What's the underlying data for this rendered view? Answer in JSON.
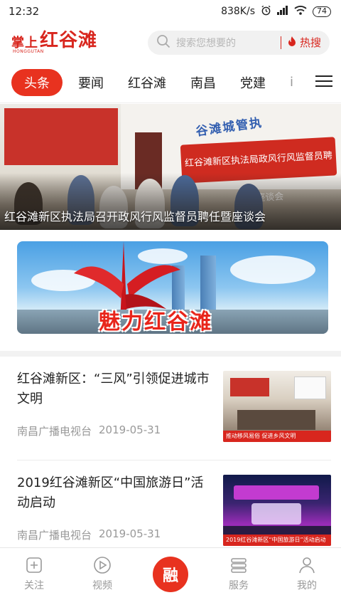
{
  "status_bar": {
    "time": "12:32",
    "network_speed": "838K/s",
    "battery": "74"
  },
  "header": {
    "logo_small": "掌上",
    "logo_main": "红谷滩",
    "logo_sub": "HONGGUTAN",
    "search_placeholder": "搜索您想要的",
    "hot_search_label": "热搜"
  },
  "tabs": [
    {
      "label": "头条",
      "active": true
    },
    {
      "label": "要闻",
      "active": false
    },
    {
      "label": "红谷滩",
      "active": false
    },
    {
      "label": "南昌",
      "active": false
    },
    {
      "label": "党建",
      "active": false
    }
  ],
  "tab_partial": "i",
  "hero": {
    "caption": "红谷滩新区执法局召开政风行风监督员聘任暨座谈会",
    "banner_text": "红谷滩新区执法局政风行风监督员聘任暨座谈会",
    "arc_text": "谷滩城管执"
  },
  "promo": {
    "title": "魅力红谷滩"
  },
  "news": [
    {
      "title": "红谷滩新区：“三风”引领促进城市文明",
      "source": "南昌广播电视台",
      "date": "2019-05-31",
      "thumb_caption": "推动移风易俗 促进乡风文明"
    },
    {
      "title": "2019红谷滩新区“中国旅游日”活动启动",
      "source": "南昌广播电视台",
      "date": "2019-05-31",
      "thumb_caption": "2019红谷滩新区“中国旅游日”活动启动"
    }
  ],
  "bottom_nav": [
    {
      "label": "关注",
      "icon": "plus-square-icon"
    },
    {
      "label": "视频",
      "icon": "play-circle-icon"
    },
    {
      "label": "融",
      "icon": "center-rong-icon"
    },
    {
      "label": "服务",
      "icon": "list-icon"
    },
    {
      "label": "我的",
      "icon": "user-icon"
    }
  ],
  "colors": {
    "accent": "#e8321f",
    "brand": "#d8261e",
    "muted": "#999999"
  }
}
